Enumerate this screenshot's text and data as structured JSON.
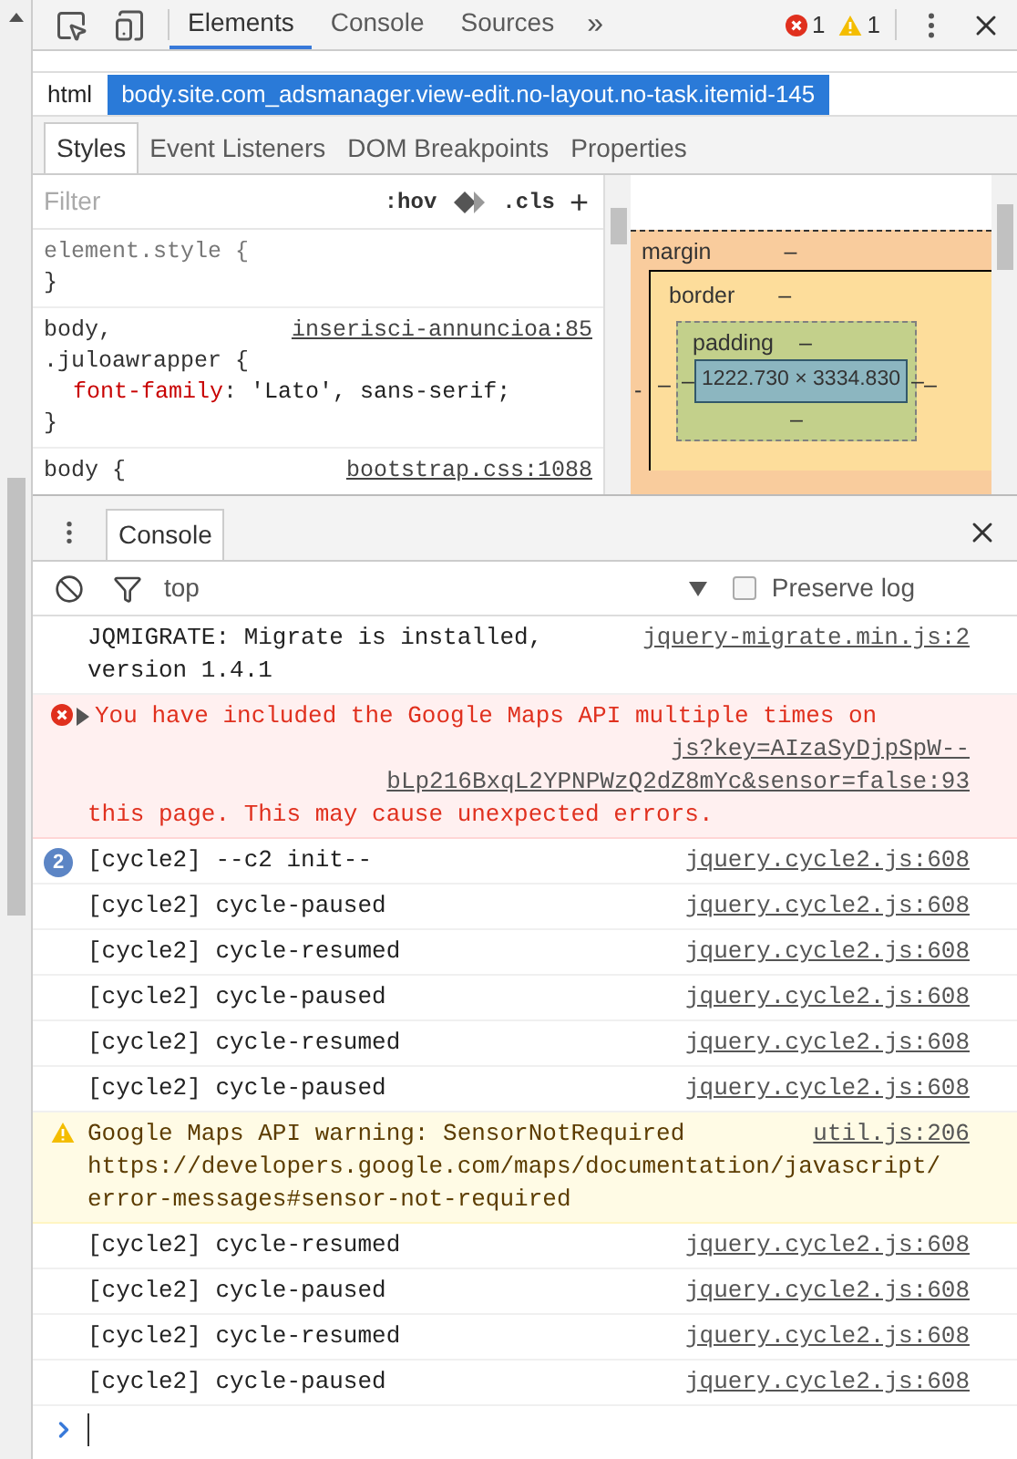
{
  "toolbar": {
    "tabs": [
      {
        "label": "Elements",
        "selected": true
      },
      {
        "label": "Console",
        "selected": false
      },
      {
        "label": "Sources",
        "selected": false
      }
    ],
    "more": "»",
    "error_count": "1",
    "warning_count": "1"
  },
  "breadcrumbs": [
    {
      "label": "html",
      "selected": false
    },
    {
      "label": "body.site.com_adsmanager.view-edit.no-layout.no-task.itemid-145",
      "selected": true
    }
  ],
  "subtabs": [
    {
      "label": "Styles",
      "selected": true
    },
    {
      "label": "Event Listeners",
      "selected": false
    },
    {
      "label": "DOM Breakpoints",
      "selected": false
    },
    {
      "label": "Properties",
      "selected": false
    }
  ],
  "styles": {
    "filter": {
      "placeholder": "Filter"
    },
    "hov": ":hov",
    "cls": ".cls",
    "add": "+",
    "rules": [
      {
        "selector": [
          "element.style {"
        ],
        "closing": "}"
      },
      {
        "selector": [
          "body,",
          ".juloawrapper {"
        ],
        "source": "inserisci-annuncioa:85",
        "declarations": [
          {
            "property": "font-family",
            "separator": ":",
            "value": "'Lato', sans-serif;"
          }
        ],
        "closing": "}"
      },
      {
        "selector": [
          "body {"
        ],
        "source": "bootstrap.css:1088"
      }
    ]
  },
  "box_model": {
    "margin_label": "margin",
    "margin_top": "–",
    "border_label": "border",
    "border_top": "–",
    "padding_label": "padding",
    "padding_top": "–",
    "content": "1222.730 × 3334.830",
    "left": [
      "-",
      "–",
      "–"
    ],
    "right": [
      "–",
      "–"
    ],
    "padding_bottom": "–"
  },
  "drawer": {
    "tab": "Console",
    "context": "top",
    "preserve_log": {
      "label": "Preserve log",
      "checked": false
    },
    "messages": [
      {
        "kind": "log",
        "lines": [
          "JQMIGRATE: Migrate is installed,",
          "version 1.4.1"
        ],
        "source": [
          "jquery-migrate.min.js:2"
        ]
      },
      {
        "kind": "error",
        "lines": [
          "You have included the Google Maps API multiple times on"
        ],
        "source": [
          "js?key=AIzaSyDjpSpW--",
          "bLp216BxqL2YPNPWzQ2dZ8mYc&sensor=false:93"
        ],
        "after": [
          "this page. This may cause unexpected errors."
        ]
      },
      {
        "kind": "log",
        "count": "2",
        "lines": [
          "[cycle2] --c2 init--"
        ],
        "source": [
          "jquery.cycle2.js:608"
        ]
      },
      {
        "kind": "log",
        "lines": [
          "[cycle2] cycle-paused"
        ],
        "source": [
          "jquery.cycle2.js:608"
        ]
      },
      {
        "kind": "log",
        "lines": [
          "[cycle2] cycle-resumed"
        ],
        "source": [
          "jquery.cycle2.js:608"
        ]
      },
      {
        "kind": "log",
        "lines": [
          "[cycle2] cycle-paused"
        ],
        "source": [
          "jquery.cycle2.js:608"
        ]
      },
      {
        "kind": "log",
        "lines": [
          "[cycle2] cycle-resumed"
        ],
        "source": [
          "jquery.cycle2.js:608"
        ]
      },
      {
        "kind": "log",
        "lines": [
          "[cycle2] cycle-paused"
        ],
        "source": [
          "jquery.cycle2.js:608"
        ]
      },
      {
        "kind": "warning",
        "lines": [
          "Google Maps API warning: SensorNotRequired"
        ],
        "source": [
          "util.js:206"
        ],
        "after": [
          "https://developers.google.com/maps/documentation/javascript/",
          "error-messages#sensor-not-required"
        ]
      },
      {
        "kind": "log",
        "lines": [
          "[cycle2] cycle-resumed"
        ],
        "source": [
          "jquery.cycle2.js:608"
        ]
      },
      {
        "kind": "log",
        "lines": [
          "[cycle2] cycle-paused"
        ],
        "source": [
          "jquery.cycle2.js:608"
        ]
      },
      {
        "kind": "log",
        "lines": [
          "[cycle2] cycle-resumed"
        ],
        "source": [
          "jquery.cycle2.js:608"
        ]
      },
      {
        "kind": "log",
        "lines": [
          "[cycle2] cycle-paused"
        ],
        "source": [
          "jquery.cycle2.js:608"
        ]
      }
    ]
  }
}
